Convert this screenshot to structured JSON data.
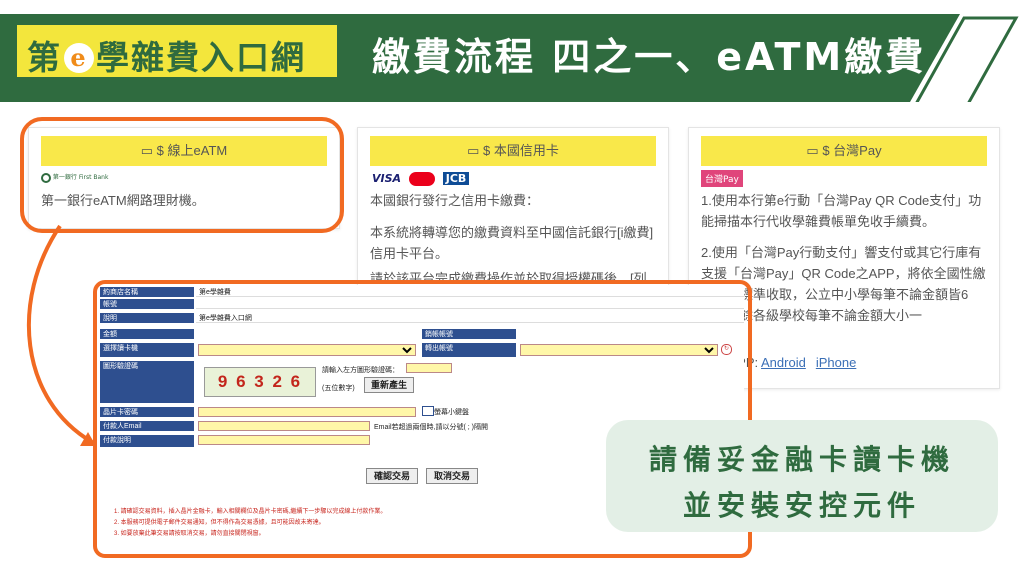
{
  "header": {
    "logo_prefix": "第",
    "logo_e": "e",
    "logo_suffix": "學雜費入口網",
    "title": "繳費流程 四之一、eATM繳費"
  },
  "cards": [
    {
      "heading": "$ 線上eATM",
      "logo_text": "第一銀行 First Bank",
      "lines": [
        "第一銀行eATM網路理財機。"
      ]
    },
    {
      "heading": "$ 本國信用卡",
      "brands": [
        "VISA",
        "MasterCard",
        "JCB"
      ],
      "lines": [
        "本國銀行發行之信用卡繳費：",
        "本系統將轉導您的繳費資料至中國信託銀行[i繳費]信用卡平台。",
        "請於該平台完成繳費操作並於取得授權碼後，[列"
      ]
    },
    {
      "heading": "$ 台灣Pay",
      "badge": "台灣Pay",
      "lines": [
        "1.使用本行第e行動「台灣Pay QR Code支付」功能掃描本行代收學雜費帳單免收手續費。",
        "2.使用「台灣Pay行動支付」響支付或其它行庫有支援「台灣Pay」QR Code之APP，將依全國性繳手續費標準收取，公立中小學每筆不論金額皆6元，其餘各級學校每筆不論金額大小一"
      ],
      "download_label": "load APP:",
      "download_links": [
        "Android",
        "iPhone"
      ]
    }
  ],
  "form": {
    "rows": [
      {
        "label": "約商店名稱",
        "value": "第e學雜費"
      },
      {
        "label": "帳號",
        "value": ""
      },
      {
        "label": "說明",
        "value": "第e學雜費入口網"
      },
      {
        "label": "金額",
        "value": ""
      },
      {
        "label": "選擇讀卡機",
        "value": ""
      }
    ],
    "transfer_account_label": "銷帳帳號",
    "out_account_label": "轉出帳號",
    "captcha_label": "圖形驗證碼",
    "captcha_image_text": "9 6 3 2 6",
    "captcha_prompt": "請輸入左方圖形驗證碼：",
    "captcha_hint": "(五位數字)",
    "captcha_refresh": "重新產生",
    "card_pin_label": "晶片卡密碼",
    "keyboard_label": "螢幕小鍵盤",
    "email_label": "付款人Email",
    "email_hint": "Email若超過兩個時,請以分號( ; )隔開",
    "memo_label": "付款說明",
    "confirm_button": "確認交易",
    "cancel_button": "取消交易",
    "notes": [
      "1. 請確認交易資料，插入晶片金融卡，輸入相關欄位及晶片卡密碼,繼續下一步驟以完成線上付款作業。",
      "2. 本服務可提供電子郵件交易通知，但不得作為交易憑據，且可能因故未寄達。",
      "3. 如要放棄此筆交易請按取消交易，請勿直接關閉視窗。"
    ]
  },
  "callout": {
    "line1": "請備妥金融卡讀卡機",
    "line2": "並安裝安控元件"
  },
  "colors": {
    "banner_green": "#2f6b3f",
    "logo_yellow": "#f3e63c",
    "accent_orange": "#f16a22",
    "card_header_yellow": "#f9e84a",
    "callout_bg": "#e3efe6"
  }
}
